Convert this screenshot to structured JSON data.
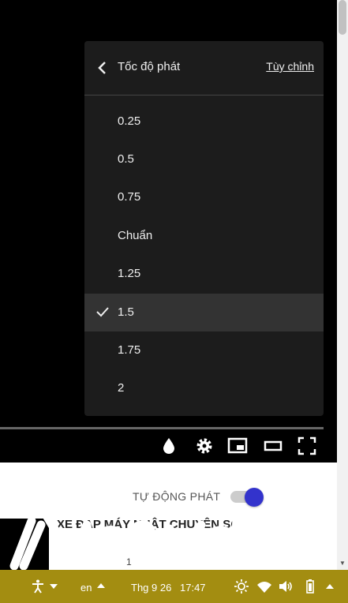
{
  "speed_menu": {
    "title": "Tốc độ phát",
    "custom_label": "Tùy chỉnh",
    "options": [
      "0.25",
      "0.5",
      "0.75",
      "Chuẩn",
      "1.25",
      "1.5",
      "1.75",
      "2"
    ],
    "selected": "1.5"
  },
  "page": {
    "autoplay_label": "TỰ ĐỘNG PHÁT",
    "autoplay_on": true,
    "video_title": "XE ĐẠP MÁY NHẬT CHUYÊN SÔ",
    "video_subtitle": "1"
  },
  "taskbar": {
    "language": "en",
    "date": "Thg 9 26",
    "time": "17:47"
  },
  "colors": {
    "menu_bg": "#1c1c1c",
    "toggle_knob": "#3333cc",
    "taskbar": "#a38d11"
  }
}
